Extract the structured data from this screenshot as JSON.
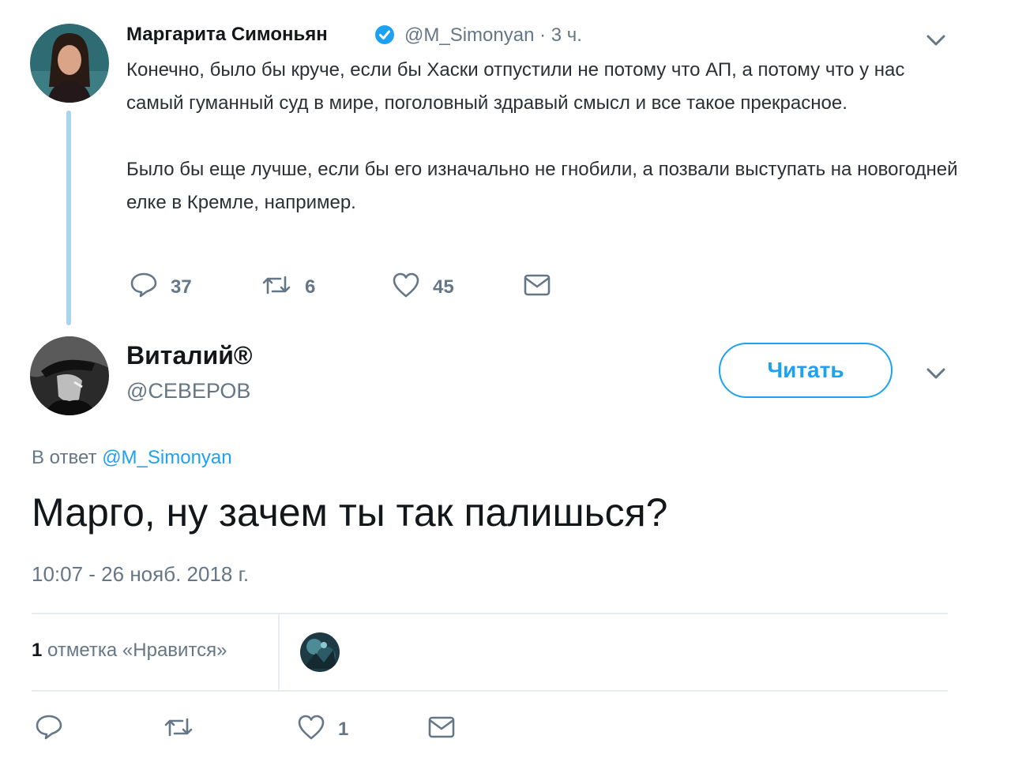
{
  "original_tweet": {
    "author_name": "Маргарита Симоньян",
    "handle": "@M_Simonyan",
    "separator": "·",
    "time_ago": "3 ч.",
    "paragraph_1": "Конечно, было бы круче, если бы Хаски отпустили не потому что АП, а потому что у нас самый гуманный суд в мире, поголовный здравый смысл и все такое прекрасное.",
    "paragraph_2": "Было бы еще лучше, если бы его изначально не гнобили, а позвали выступать на новогодней елке в Кремле, например.",
    "replies": "37",
    "retweets": "6",
    "likes": "45"
  },
  "reply_tweet": {
    "author_name": "Виталий®",
    "handle": "@СЕВЕРОВ",
    "follow_label": "Читать",
    "reply_to_prefix": "В ответ",
    "reply_to_handle": "@M_Simonyan",
    "text": "Марго, ну зачем ты так палишься?",
    "timestamp": "10:07 - 26 нояб. 2018 г.",
    "likes_count": "1",
    "likes_label": "отметка «Нравится»",
    "action_likes": "1"
  },
  "icons": {
    "reply": "reply-icon",
    "retweet": "retweet-icon",
    "like": "heart-icon",
    "dm": "envelope-icon",
    "more": "chevron-down-icon",
    "verified": "verified-badge-icon"
  },
  "colors": {
    "accent": "#1da1f2",
    "text": "#14171a",
    "muted": "#657786",
    "thread_line": "#a9d4ee",
    "divider": "#e6ecf0"
  }
}
